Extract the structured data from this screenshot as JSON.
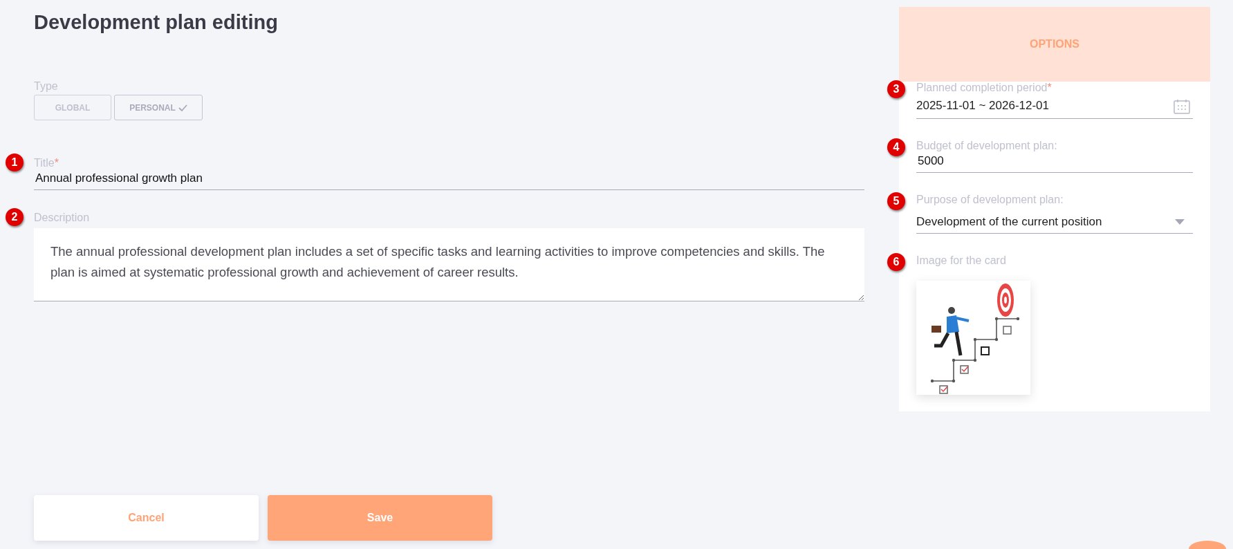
{
  "page": {
    "title": "Development plan editing"
  },
  "type_field": {
    "label": "Type",
    "options": [
      {
        "label": "GLOBAL",
        "selected": false
      },
      {
        "label": "PERSONAL",
        "selected": true
      }
    ]
  },
  "fields": [
    {
      "kind": "text",
      "marker": "1",
      "label": "Title",
      "required_mark": "*",
      "value": "Annual professional growth plan"
    },
    {
      "kind": "textarea",
      "marker": "2",
      "label": "Description",
      "value": "The annual professional development plan includes a set of specific tasks and learning activities to improve competencies and skills. The plan is aimed at systematic professional growth and achievement of career results."
    }
  ],
  "options_panel": {
    "header": "OPTIONS",
    "fields": [
      {
        "kind": "date_range",
        "marker": "3",
        "label": "Planned completion period",
        "required_mark": "*",
        "value": "2025-11-01 ~ 2026-12-01"
      },
      {
        "kind": "text",
        "marker": "4",
        "label": "Budget of development plan:",
        "value": "5000"
      },
      {
        "kind": "select",
        "marker": "5",
        "label": "Purpose of development plan:",
        "value": "Development of the current position"
      },
      {
        "kind": "image",
        "marker": "6",
        "label": "Image for the card"
      }
    ]
  },
  "buttons": [
    {
      "kind": "secondary",
      "label": "Cancel"
    },
    {
      "kind": "primary",
      "label": "Save"
    }
  ]
}
